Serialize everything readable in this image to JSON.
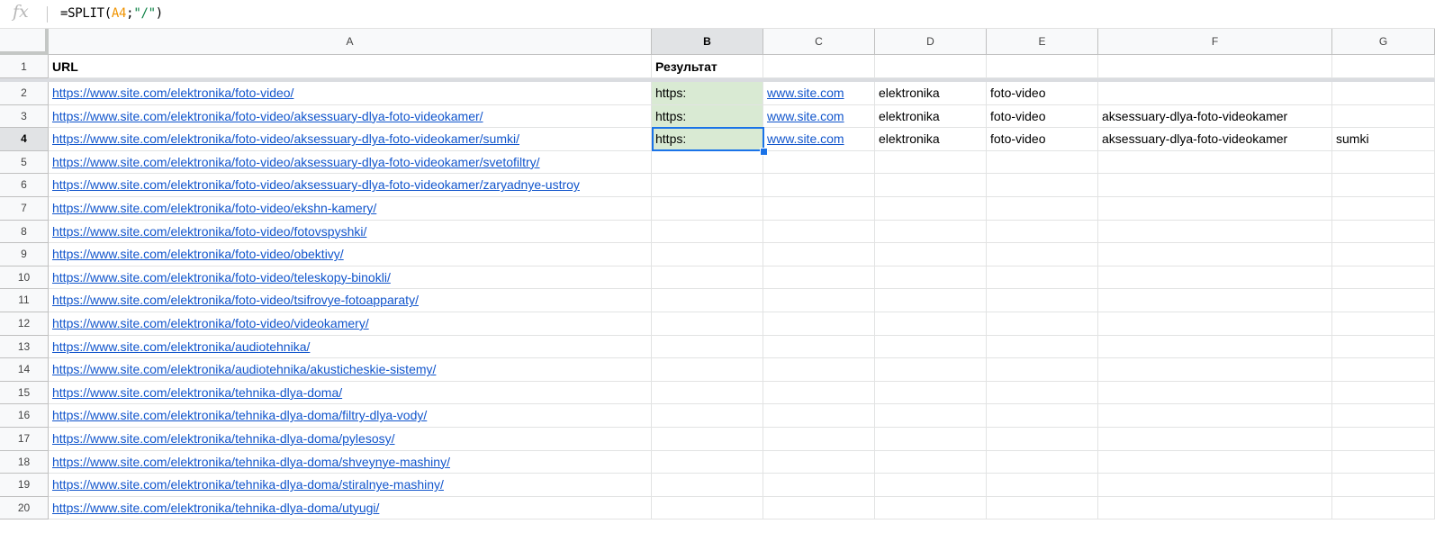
{
  "formula_bar": {
    "icon": "fx",
    "text_prefix": "=SPLIT(",
    "ref": "A4",
    "sep": ";",
    "str": "\"/\"",
    "suffix": ")"
  },
  "columns": [
    "A",
    "B",
    "C",
    "D",
    "E",
    "F",
    "G"
  ],
  "selected_column": "B",
  "selected_row": 4,
  "row_numbers": [
    "1",
    "2",
    "3",
    "4",
    "5",
    "6",
    "7",
    "8",
    "9",
    "10",
    "11",
    "12",
    "13",
    "14",
    "15",
    "16",
    "17",
    "18",
    "19",
    "20"
  ],
  "rows": [
    {
      "A": "URL",
      "B": "Результат",
      "C": "",
      "D": "",
      "E": "",
      "F": "",
      "G": ""
    },
    {
      "A": "https://www.site.com/elektronika/foto-video/",
      "B": "https:",
      "C": "www.site.com",
      "D": "elektronika",
      "E": "foto-video",
      "F": "",
      "G": ""
    },
    {
      "A": "https://www.site.com/elektronika/foto-video/aksessuary-dlya-foto-videokamer/",
      "B": "https:",
      "C": "www.site.com",
      "D": "elektronika",
      "E": "foto-video",
      "F": "aksessuary-dlya-foto-videokamer",
      "G": ""
    },
    {
      "A": "https://www.site.com/elektronika/foto-video/aksessuary-dlya-foto-videokamer/sumki/",
      "B": "https:",
      "C": "www.site.com",
      "D": "elektronika",
      "E": "foto-video",
      "F": "aksessuary-dlya-foto-videokamer",
      "G": "sumki"
    },
    {
      "A": "https://www.site.com/elektronika/foto-video/aksessuary-dlya-foto-videokamer/svetofiltry/"
    },
    {
      "A": "https://www.site.com/elektronika/foto-video/aksessuary-dlya-foto-videokamer/zaryadnye-ustroy"
    },
    {
      "A": "https://www.site.com/elektronika/foto-video/ekshn-kamery/"
    },
    {
      "A": "https://www.site.com/elektronika/foto-video/fotovspyshki/"
    },
    {
      "A": "https://www.site.com/elektronika/foto-video/obektivy/"
    },
    {
      "A": "https://www.site.com/elektronika/foto-video/teleskopy-binokli/"
    },
    {
      "A": "https://www.site.com/elektronika/foto-video/tsifrovye-fotoapparaty/"
    },
    {
      "A": "https://www.site.com/elektronika/foto-video/videokamery/"
    },
    {
      "A": "https://www.site.com/elektronika/audiotehnika/"
    },
    {
      "A": "https://www.site.com/elektronika/audiotehnika/akusticheskie-sistemy/"
    },
    {
      "A": "https://www.site.com/elektronika/tehnika-dlya-doma/"
    },
    {
      "A": "https://www.site.com/elektronika/tehnika-dlya-doma/filtry-dlya-vody/"
    },
    {
      "A": "https://www.site.com/elektronika/tehnika-dlya-doma/pylesosy/"
    },
    {
      "A": "https://www.site.com/elektronika/tehnika-dlya-doma/shveynye-mashiny/"
    },
    {
      "A": "https://www.site.com/elektronika/tehnika-dlya-doma/stiralnye-mashiny/"
    },
    {
      "A": "https://www.site.com/elektronika/tehnika-dlya-doma/utyugi/"
    }
  ],
  "colors": {
    "link": "#1155cc",
    "result_fill": "#d9ead3",
    "selection": "#1a73e8",
    "formula_ref": "#f09300",
    "formula_string": "#0b8043"
  }
}
